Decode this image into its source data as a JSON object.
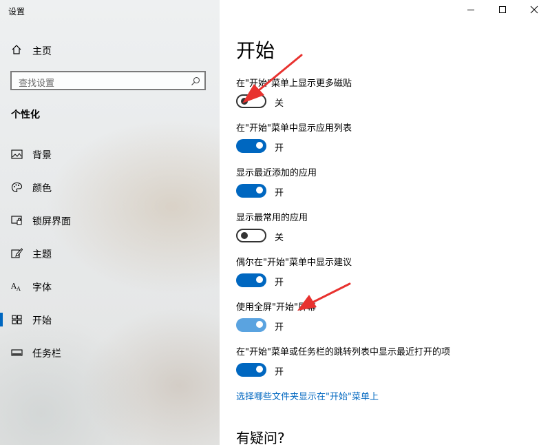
{
  "window": {
    "title": "设置",
    "minimize_icon": "minimize-icon",
    "maximize_icon": "maximize-icon",
    "close_icon": "close-icon"
  },
  "sidebar": {
    "home_label": "主页",
    "home_icon": "home-icon",
    "search_placeholder": "查找设置",
    "section_title": "个性化",
    "items": [
      {
        "label": "背景",
        "icon": "picture-icon"
      },
      {
        "label": "颜色",
        "icon": "palette-icon"
      },
      {
        "label": "锁屏界面",
        "icon": "lock-screen-icon"
      },
      {
        "label": "主题",
        "icon": "theme-brush-icon"
      },
      {
        "label": "字体",
        "icon": "font-icon"
      },
      {
        "label": "开始",
        "icon": "start-grid-icon",
        "active": true
      },
      {
        "label": "任务栏",
        "icon": "taskbar-icon"
      }
    ]
  },
  "main": {
    "title": "开始",
    "settings": [
      {
        "label": "在\"开始\"菜单上显示更多磁贴",
        "state": "关",
        "on": false
      },
      {
        "label": "在\"开始\"菜单中显示应用列表",
        "state": "开",
        "on": true
      },
      {
        "label": "显示最近添加的应用",
        "state": "开",
        "on": true
      },
      {
        "label": "显示最常用的应用",
        "state": "关",
        "on": false
      },
      {
        "label": "偶尔在\"开始\"菜单中显示建议",
        "state": "开",
        "on": true
      },
      {
        "label": "使用全屏\"开始\"屏幕",
        "state": "开",
        "on": true
      },
      {
        "label": "在\"开始\"菜单或任务栏的跳转列表中显示最近打开的项",
        "state": "开",
        "on": true
      }
    ],
    "link": "选择哪些文件夹显示在\"开始\"菜单上",
    "help_title": "有疑问?"
  },
  "colors": {
    "accent": "#0067c0",
    "accent_light": "#5aa3e0",
    "annotation": "#e8322f"
  }
}
